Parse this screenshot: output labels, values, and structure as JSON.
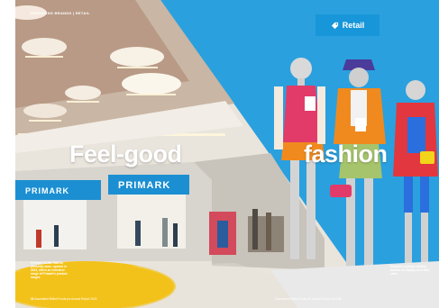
{
  "page": {
    "kicker": "OPERATING BRANDS | RETAIL",
    "section_tag": "Retail",
    "headline_left": "Feel-good",
    "headline_right": "fashion",
    "caption_left": "Primark’s Ardis Galleria (Helsinki) store, opened in 2023, offers an extensive range of Primark’s product ranges",
    "caption_right": "Primark’s summer holiday fashion on display at a retail store",
    "store_sign_1": "PRIMARK",
    "store_sign_2": "PRIMARK",
    "folio_left_page": "32",
    "folio_left_text": "Associated British Foods plc  Annual Report 2023",
    "folio_right_page": "33",
    "folio_right_text": "Associated British Foods plc  Annual Report 2023"
  },
  "colors": {
    "accent_blue": "#1796d9",
    "sky_blue": "#2ba0de"
  },
  "icons": {
    "section_tag_icon": "tag-icon"
  }
}
